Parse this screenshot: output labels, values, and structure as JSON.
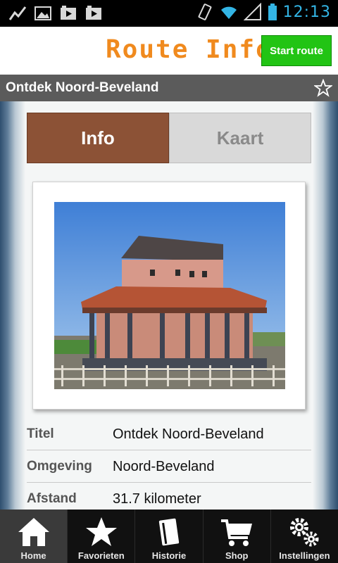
{
  "status_bar": {
    "time": "12:13",
    "icons": [
      "activity-icon",
      "image-icon",
      "play-icon",
      "play-icon",
      "vibrate-icon",
      "wifi-icon",
      "signal-icon",
      "battery-icon"
    ]
  },
  "header": {
    "title": "Route Info",
    "start_button": "Start route"
  },
  "route_bar": {
    "title": "Ontdek Noord-Beveland",
    "favorite_icon": "star-outline-icon"
  },
  "tabs": [
    {
      "label": "Info",
      "active": true
    },
    {
      "label": "Kaart",
      "active": false
    }
  ],
  "photo": {
    "subject": "building-photo"
  },
  "details": [
    {
      "key": "Titel",
      "value": "Ontdek Noord-Beveland"
    },
    {
      "key": "Omgeving",
      "value": "Noord-Beveland"
    },
    {
      "key": "Afstand",
      "value": "31.7 kilometer"
    }
  ],
  "bottom_nav": [
    {
      "label": "Home",
      "icon": "home-icon",
      "active": true
    },
    {
      "label": "Favorieten",
      "icon": "star-icon",
      "active": false
    },
    {
      "label": "Historie",
      "icon": "book-icon",
      "active": false
    },
    {
      "label": "Shop",
      "icon": "cart-icon",
      "active": false
    },
    {
      "label": "Instellingen",
      "icon": "gears-icon",
      "active": false
    }
  ],
  "colors": {
    "accent_orange": "#f08a1e",
    "start_green": "#22c414",
    "tab_active": "#8c5236",
    "statusbar_blue": "#33b5e5"
  }
}
